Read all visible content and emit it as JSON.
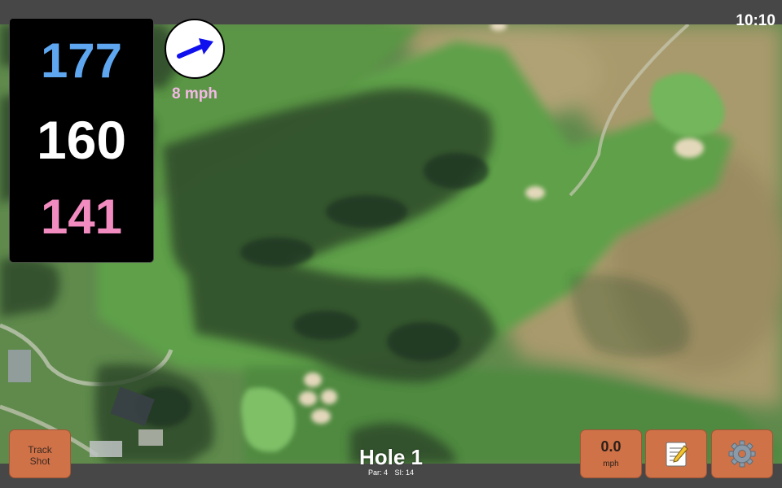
{
  "status_bar": {
    "time": "10:10"
  },
  "distances": {
    "back": "177",
    "center": "160",
    "front": "141",
    "colors": {
      "back": "#5ea7f0",
      "center": "#ffffff",
      "front": "#f28cc0"
    }
  },
  "wind": {
    "speed_label": "8 mph",
    "arrow_icon": "arrow-right-up-icon",
    "color": "#f4b8e6",
    "arrow_color": "#1010ee"
  },
  "hole": {
    "title": "Hole 1",
    "par": "Par: 4",
    "stroke_index": "SI: 14"
  },
  "buttons": {
    "track_shot_line1": "Track",
    "track_shot_line2": "Shot",
    "speed_value": "0.0",
    "speed_unit": "mph",
    "scorecard_icon": "notepad-icon",
    "settings_icon": "gear-icon",
    "color": "#d07248"
  },
  "map": {
    "type": "satellite-golf-hole"
  }
}
